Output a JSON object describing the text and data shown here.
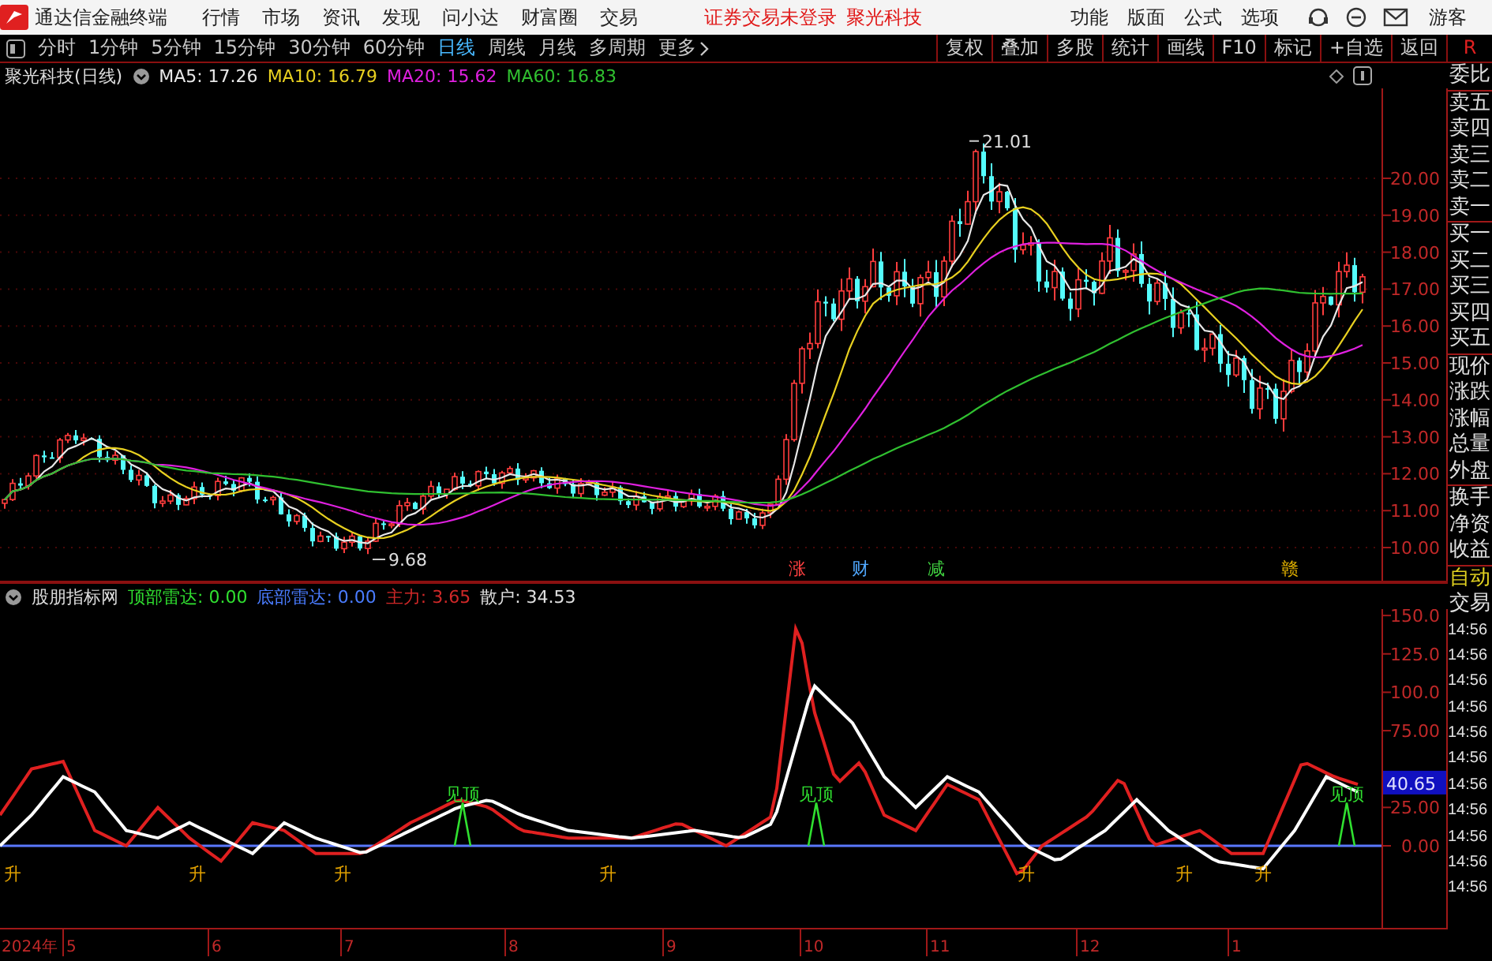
{
  "top_bar": {
    "app_title": "通达信金融终端",
    "menu": [
      "行情",
      "市场",
      "资讯",
      "发现",
      "问小达",
      "财富圈",
      "交易"
    ],
    "notices": [
      "证券交易未登录",
      "聚光科技"
    ],
    "tools": [
      "功能",
      "版面",
      "公式",
      "选项"
    ],
    "user": "游客"
  },
  "periods": [
    {
      "label": "分时",
      "selected": false
    },
    {
      "label": "1分钟",
      "selected": false
    },
    {
      "label": "5分钟",
      "selected": false
    },
    {
      "label": "15分钟",
      "selected": false
    },
    {
      "label": "30分钟",
      "selected": false
    },
    {
      "label": "60分钟",
      "selected": false
    },
    {
      "label": "日线",
      "selected": true
    },
    {
      "label": "周线",
      "selected": false
    },
    {
      "label": "月线",
      "selected": false
    },
    {
      "label": "多周期",
      "selected": false
    },
    {
      "label": "更多",
      "selected": false
    }
  ],
  "chart_buttons": [
    "复权",
    "叠加",
    "多股",
    "统计",
    "画线",
    "F10",
    "标记",
    "+自选",
    "返回"
  ],
  "panel_tab": "R",
  "price_chart": {
    "title": "聚光科技(日线)",
    "ma_legend": [
      {
        "label": "MA5: 17.26",
        "color": "#e8e8e8"
      },
      {
        "label": "MA10: 16.79",
        "color": "#e8d020"
      },
      {
        "label": "MA20: 15.62",
        "color": "#e020e0"
      },
      {
        "label": "MA60: 16.83",
        "color": "#30c030"
      }
    ],
    "axis_labels": [
      "20.00",
      "19.00",
      "18.00",
      "17.00",
      "16.00",
      "15.00",
      "14.00",
      "13.00",
      "12.00",
      "11.00",
      "10.00"
    ],
    "high_label": "21.01",
    "low_label": "9.68",
    "events": [
      {
        "label": "涨",
        "color": "#ff4040"
      },
      {
        "label": "财",
        "color": "#50a8ff"
      },
      {
        "label": "减",
        "color": "#40d040"
      },
      {
        "label": "赣",
        "color": "#e0b000"
      }
    ]
  },
  "indicator": {
    "name": "股朋指标网",
    "readings": [
      {
        "label": "顶部雷达: 0.00",
        "color": "#30e030"
      },
      {
        "label": "底部雷达: 0.00",
        "color": "#4a7cff"
      },
      {
        "label": "主力: 3.65",
        "color": "#d02828"
      },
      {
        "label": "散户: 34.53",
        "color": "#e0e0e0"
      }
    ],
    "axis_labels": [
      "150.0",
      "125.0",
      "100.0",
      "75.00",
      "25.00",
      "0.00"
    ],
    "current_value": "40.65",
    "signals": [
      {
        "kind": "rise",
        "label": "升"
      },
      {
        "kind": "rise",
        "label": "升"
      },
      {
        "kind": "rise",
        "label": "升"
      },
      {
        "kind": "top",
        "label": "见顶"
      },
      {
        "kind": "rise",
        "label": "升"
      },
      {
        "kind": "top",
        "label": "见顶"
      },
      {
        "kind": "rise",
        "label": "升"
      },
      {
        "kind": "rise",
        "label": "升"
      },
      {
        "kind": "rise",
        "label": "升"
      },
      {
        "kind": "top",
        "label": "见顶"
      }
    ]
  },
  "time_axis": {
    "year": "2024年",
    "months": [
      "5",
      "6",
      "7",
      "8",
      "9",
      "10",
      "11",
      "12",
      "1"
    ]
  },
  "quote_panel": {
    "fields": [
      {
        "label": "委比",
        "kind": "field"
      },
      {
        "label": "卖五",
        "kind": "field"
      },
      {
        "label": "卖四",
        "kind": "field"
      },
      {
        "label": "卖三",
        "kind": "field"
      },
      {
        "label": "卖二",
        "kind": "field"
      },
      {
        "label": "卖一",
        "kind": "field"
      },
      {
        "label": "买一",
        "kind": "field"
      },
      {
        "label": "买二",
        "kind": "field"
      },
      {
        "label": "买三",
        "kind": "field"
      },
      {
        "label": "买四",
        "kind": "field"
      },
      {
        "label": "买五",
        "kind": "field"
      },
      {
        "label": "现价",
        "kind": "field"
      },
      {
        "label": "涨跌",
        "kind": "field"
      },
      {
        "label": "涨幅",
        "kind": "field"
      },
      {
        "label": "总量",
        "kind": "field"
      },
      {
        "label": "外盘",
        "kind": "field"
      },
      {
        "label": "换手",
        "kind": "field"
      },
      {
        "label": "净资",
        "kind": "field"
      },
      {
        "label": "收益",
        "kind": "field"
      },
      {
        "label": "自动",
        "kind": "mode"
      },
      {
        "label": "交易",
        "kind": "field"
      }
    ],
    "times": [
      "14:56",
      "14:56",
      "14:56",
      "14:56",
      "14:56",
      "14:56",
      "14:56",
      "14:56",
      "14:56",
      "14:56",
      "14:56"
    ]
  }
}
